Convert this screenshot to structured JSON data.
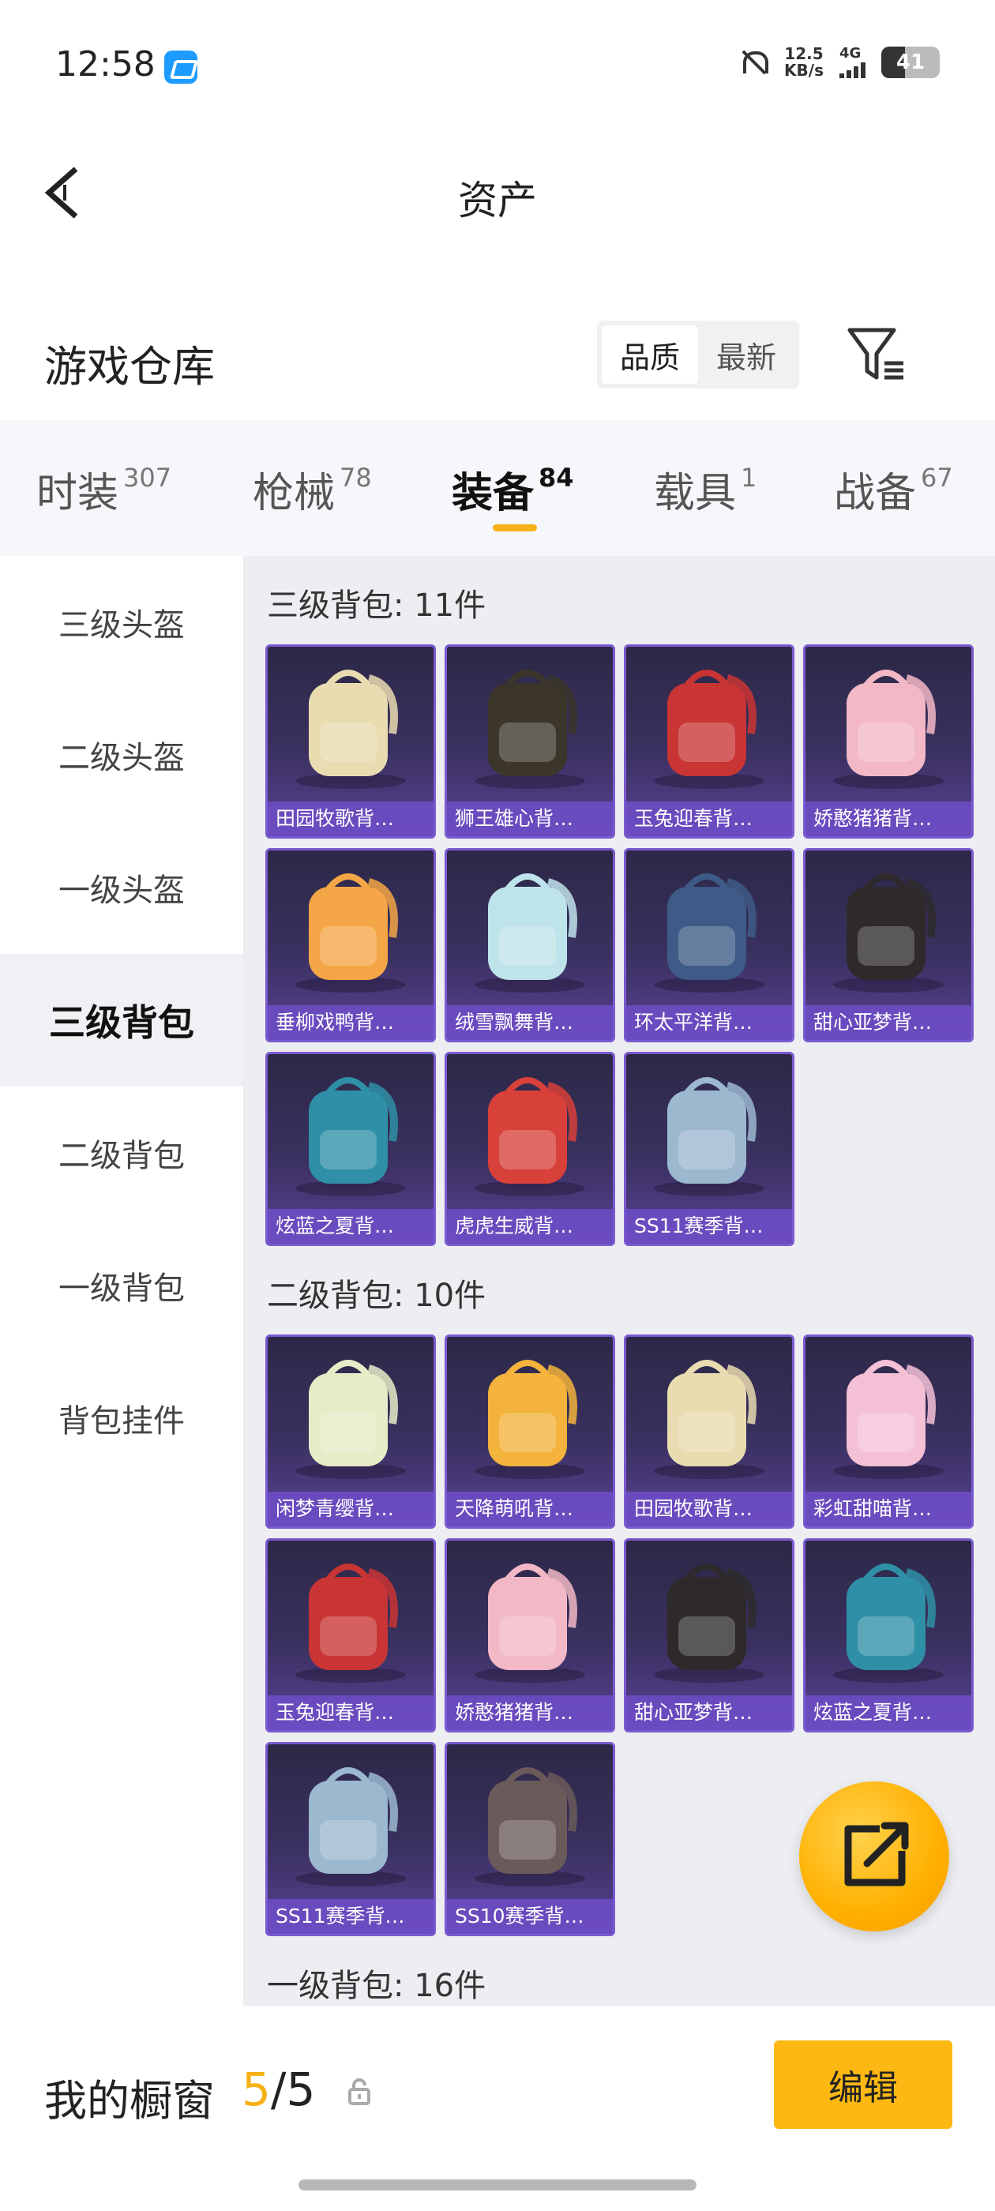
{
  "status_bar": {
    "time": "12:58",
    "net_speed_value": "12.5",
    "net_speed_unit": "KB/s",
    "network_type": "4G",
    "battery": "41",
    "battery_level": 0.41,
    "icons": [
      "app-icon",
      "bell-muted-icon",
      "signal-icon",
      "battery-icon"
    ]
  },
  "header": {
    "title": "资产",
    "back_icon": "chevron-left-icon"
  },
  "warehouse": {
    "title": "游戏仓库",
    "sort_options": [
      "品质",
      "最新"
    ],
    "selected_sort": "品质",
    "filter_icon": "filter-icon"
  },
  "tabs": [
    {
      "label": "时装",
      "count": "307"
    },
    {
      "label": "枪械",
      "count": "78"
    },
    {
      "label": "装备",
      "count": "84"
    },
    {
      "label": "载具",
      "count": "1"
    },
    {
      "label": "战备",
      "count": "67"
    }
  ],
  "active_tab": "装备",
  "accent_color": "#f6b116",
  "sidebar": {
    "items": [
      "三级头盔",
      "二级头盔",
      "一级头盔",
      "三级背包",
      "二级背包",
      "一级背包",
      "背包挂件"
    ],
    "active": "三级背包"
  },
  "sections": [
    {
      "title": "三级背包: 11件",
      "items": [
        {
          "name": "田园牧歌背…",
          "color": "#e9dcb0"
        },
        {
          "name": "狮王雄心背…",
          "color": "#3b352a"
        },
        {
          "name": "玉兔迎春背…",
          "color": "#c93434"
        },
        {
          "name": "娇憨猪猪背…",
          "color": "#f2b8c6"
        },
        {
          "name": "垂柳戏鸭背…",
          "color": "#f4a646"
        },
        {
          "name": "绒雪飘舞背…",
          "color": "#bfe3ea"
        },
        {
          "name": "环太平洋背…",
          "color": "#3e5a86"
        },
        {
          "name": "甜心亚梦背…",
          "color": "#2e2a2c"
        },
        {
          "name": "炫蓝之夏背…",
          "color": "#2f8fa6"
        },
        {
          "name": "虎虎生威背…",
          "color": "#d8403a"
        },
        {
          "name": "SS11赛季背…",
          "color": "#9bb8cf"
        }
      ]
    },
    {
      "title": "二级背包: 10件",
      "items": [
        {
          "name": "闲梦青缨背…",
          "color": "#e6ecc7"
        },
        {
          "name": "天降萌吼背…",
          "color": "#f3b33c"
        },
        {
          "name": "田园牧歌背…",
          "color": "#e9dcb0"
        },
        {
          "name": "彩虹甜喵背…",
          "color": "#f4c0d6"
        },
        {
          "name": "玉兔迎春背…",
          "color": "#c93434"
        },
        {
          "name": "娇憨猪猪背…",
          "color": "#f2b8c6"
        },
        {
          "name": "甜心亚梦背…",
          "color": "#2e2a2c"
        },
        {
          "name": "炫蓝之夏背…",
          "color": "#2f8fa6"
        },
        {
          "name": "SS11赛季背…",
          "color": "#9bb8cf"
        },
        {
          "name": "SS10赛季背…",
          "color": "#6b5a5a"
        }
      ]
    },
    {
      "title": "一级背包: 16件",
      "items": []
    }
  ],
  "share_button_icon": "share-external-icon",
  "bottom_bar": {
    "showcase_label": "我的橱窗",
    "showcase_current": "5",
    "showcase_separator": "/",
    "showcase_total": "5",
    "lock_icon": "lock-icon",
    "edit_label": "编辑"
  }
}
